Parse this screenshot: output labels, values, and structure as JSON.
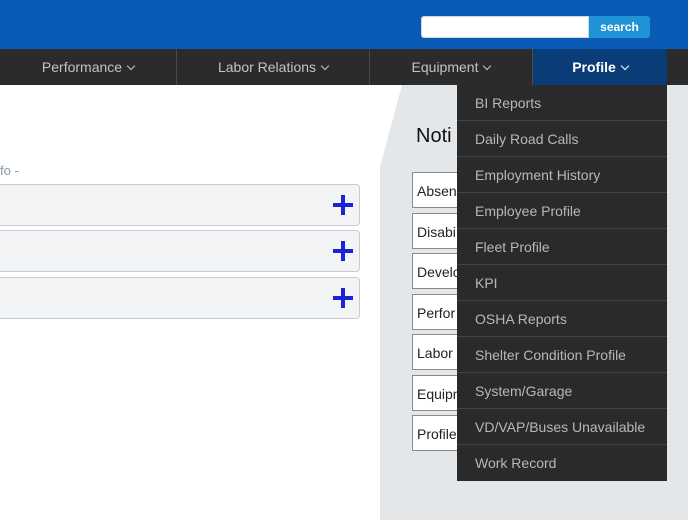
{
  "search": {
    "placeholder": "",
    "value": "",
    "button_label": "search"
  },
  "nav": {
    "items": [
      {
        "label": "Performance"
      },
      {
        "label": "Labor Relations"
      },
      {
        "label": "Equipment"
      },
      {
        "label": "Profile"
      }
    ]
  },
  "main": {
    "info_label": "fo -"
  },
  "panel": {
    "title": "Noti",
    "items": [
      "Absen",
      "Disabi",
      "Develo",
      "Perfor",
      "Labor",
      "Equipn",
      "Profile"
    ]
  },
  "dropdown": {
    "items": [
      "BI Reports",
      "Daily Road Calls",
      "Employment History",
      "Employee Profile",
      "Fleet Profile",
      "KPI",
      "OSHA Reports",
      "Shelter Condition Profile",
      "System/Garage",
      "VD/VAP/Buses Unavailable",
      "Work Record"
    ]
  },
  "colors": {
    "topbar": "#0a5bb5",
    "navbar": "#2b2b2b",
    "nav_active": "#0a3d78",
    "search_button": "#1e93d6",
    "plus_icon": "#1a24d6",
    "dropdown_bg": "#2a2a2a",
    "side_panel": "#e3e7ea"
  }
}
